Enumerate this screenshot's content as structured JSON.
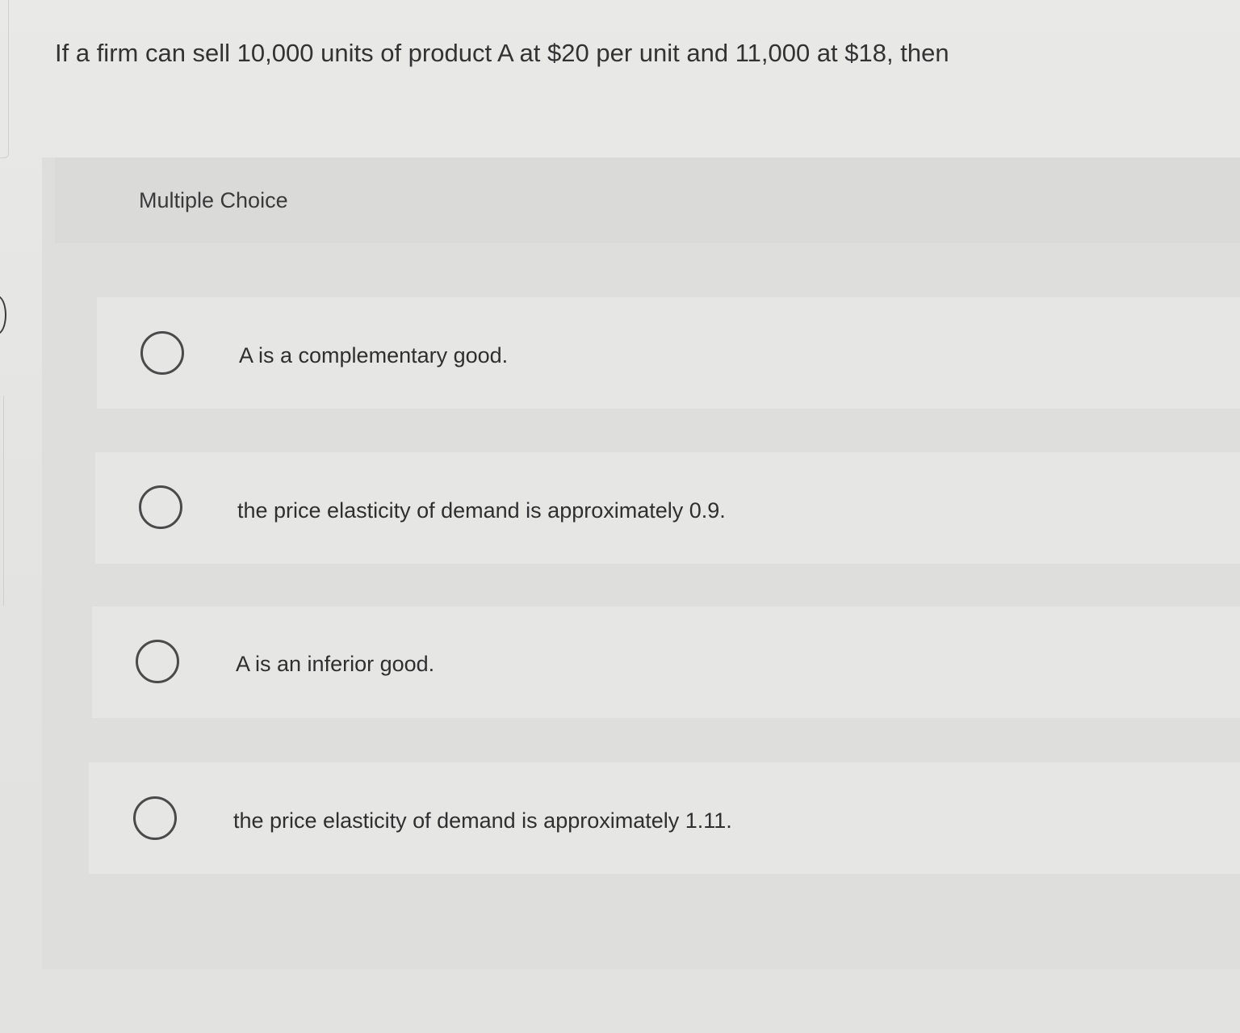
{
  "question": {
    "text": "If a firm can sell 10,000 units of product A at $20 per unit and 11,000 at $18, then"
  },
  "multiple_choice": {
    "label": "Multiple Choice",
    "options": [
      {
        "text": "A is a complementary good."
      },
      {
        "text": "the price elasticity of demand is approximately 0.9."
      },
      {
        "text": "A is an inferior good."
      },
      {
        "text": "the price elasticity of demand is approximately 1.11."
      }
    ]
  }
}
